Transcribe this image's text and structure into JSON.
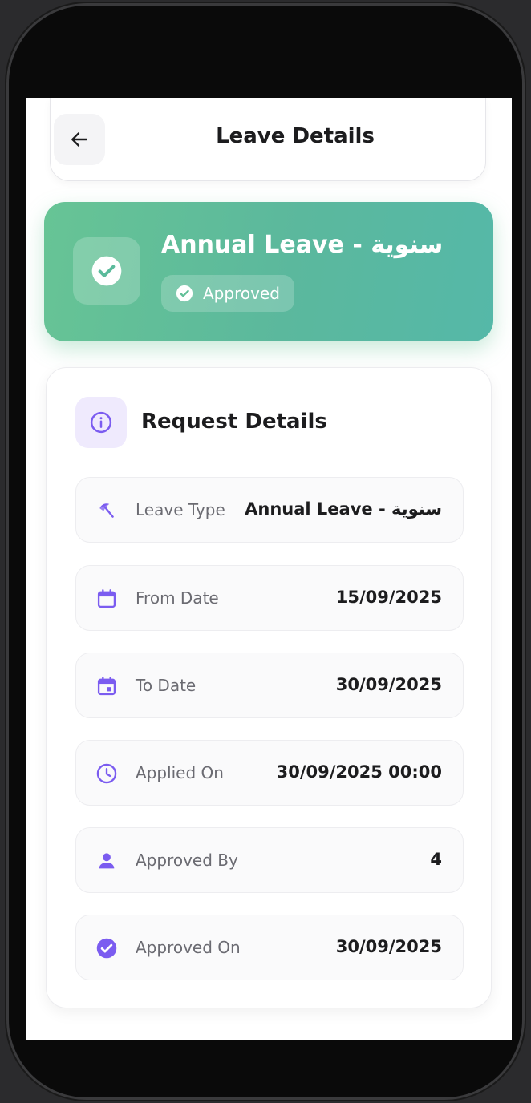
{
  "header": {
    "title": "Leave Details"
  },
  "status": {
    "title": "Annual Leave - سنوية",
    "badge": "Approved"
  },
  "details": {
    "section_title": "Request Details",
    "rows": [
      {
        "icon": "beach-umbrella-icon",
        "label": "Leave Type",
        "value": "Annual Leave - سنوية"
      },
      {
        "icon": "calendar-icon",
        "label": "From Date",
        "value": "15/09/2025"
      },
      {
        "icon": "calendar-event-icon",
        "label": "To Date",
        "value": "30/09/2025"
      },
      {
        "icon": "clock-icon",
        "label": "Applied On",
        "value": "30/09/2025 00:00"
      },
      {
        "icon": "person-icon",
        "label": "Approved By",
        "value": "4"
      },
      {
        "icon": "check-circle-icon",
        "label": "Approved On",
        "value": "30/09/2025"
      }
    ]
  },
  "colors": {
    "accent": "#7b5cf0",
    "status_green": "#66c496",
    "status_teal": "#55b8a8"
  }
}
